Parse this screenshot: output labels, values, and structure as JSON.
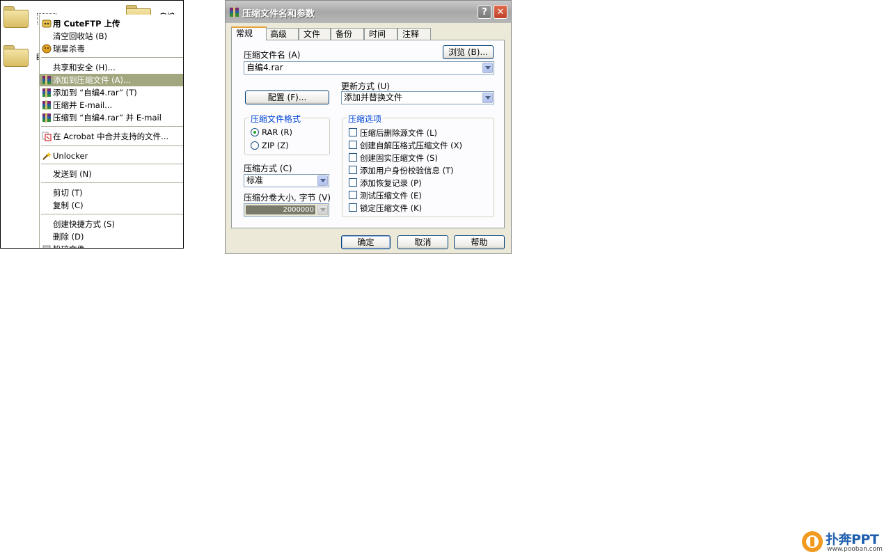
{
  "explorer": {
    "folder_labels": [
      "自编",
      "自编",
      "自编"
    ]
  },
  "context_menu": {
    "items": [
      {
        "label": "用 CuteFTP 上传",
        "icon": "cuteftp-icon",
        "bold": true
      },
      {
        "label": "清空回收站 (B)",
        "icon": "",
        "bold": false
      },
      {
        "label": "瑞星杀毒",
        "icon": "rising-antivirus-icon",
        "bold": false
      },
      {
        "label": "共享和安全 (H)...",
        "icon": "",
        "bold": false
      },
      {
        "label": "添加到压缩文件 (A)...",
        "icon": "winrar-icon",
        "bold": false,
        "highlighted": true
      },
      {
        "label": "添加到 “自编4.rar” (T)",
        "icon": "winrar-icon",
        "bold": false
      },
      {
        "label": "压缩并 E-mail...",
        "icon": "winrar-icon",
        "bold": false
      },
      {
        "label": "压缩到 “自编4.rar” 并 E-mail",
        "icon": "winrar-icon",
        "bold": false
      },
      {
        "label": "在 Acrobat 中合并支持的文件...",
        "icon": "acrobat-icon",
        "bold": false
      },
      {
        "label": "Unlocker",
        "icon": "unlocker-wand-icon",
        "bold": false
      },
      {
        "label": "发送到 (N)",
        "icon": "",
        "bold": false
      },
      {
        "label": "剪切 (T)",
        "icon": "",
        "bold": false
      },
      {
        "label": "复制 (C)",
        "icon": "",
        "bold": false
      },
      {
        "label": "创建快捷方式 (S)",
        "icon": "",
        "bold": false
      },
      {
        "label": "删除 (D)",
        "icon": "",
        "bold": false
      },
      {
        "label": "粉碎文件",
        "icon": "shred-icon",
        "bold": false
      }
    ],
    "highlight_color": "#a3a780"
  },
  "dialog": {
    "title": "压缩文件名和参数",
    "help_button": "?",
    "close_button": "✕",
    "tabs": [
      "常规",
      "高级",
      "文件",
      "备份",
      "时间",
      "注释"
    ],
    "active_tab": "常规",
    "archive_name_label": "压缩文件名 (A)",
    "browse_button": "浏览 (B)...",
    "archive_name_value": "自编4.rar",
    "profiles_button": "配置 (F)...",
    "update_mode_label": "更新方式 (U)",
    "update_mode_value": "添加并替换文件",
    "format_group_title": "压缩文件格式",
    "format_options": [
      {
        "label": "RAR (R)",
        "selected": true
      },
      {
        "label": "ZIP (Z)",
        "selected": false
      }
    ],
    "method_label": "压缩方式 (C)",
    "method_value": "标准",
    "volume_label": "压缩分卷大小, 字节 (V)",
    "volume_value": "2000000",
    "options_group_title": "压缩选项",
    "options": [
      {
        "label": "压缩后删除源文件 (L)",
        "checked": false
      },
      {
        "label": "创建自解压格式压缩文件 (X)",
        "checked": false
      },
      {
        "label": "创建固实压缩文件 (S)",
        "checked": false
      },
      {
        "label": "添加用户身份校验信息 (T)",
        "checked": false
      },
      {
        "label": "添加恢复记录 (P)",
        "checked": false
      },
      {
        "label": "测试压缩文件 (E)",
        "checked": false
      },
      {
        "label": "锁定压缩文件 (K)",
        "checked": false
      }
    ],
    "ok_button": "确定",
    "cancel_button": "取消",
    "help_button_bottom": "帮助"
  },
  "watermark": {
    "brand": "扑奔PPT",
    "url": "www.pooban.com"
  }
}
